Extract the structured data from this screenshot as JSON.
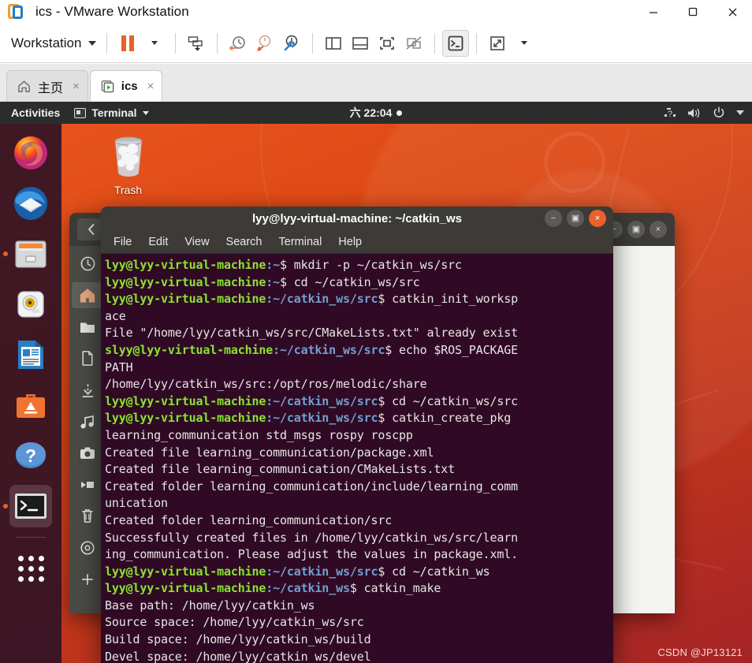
{
  "vmware": {
    "window_title": "ics - VMware Workstation",
    "logo_icon": "vmware-logo-icon",
    "window_buttons": [
      {
        "name": "minimize-button",
        "glyph": "minimize-icon"
      },
      {
        "name": "restore-button",
        "glyph": "restore-icon"
      },
      {
        "name": "close-button",
        "glyph": "close-icon"
      }
    ],
    "toolbar": {
      "menu_label": "Workstation",
      "menu_caret": "chevron-down-icon",
      "buttons": [
        {
          "name": "pause-vm-button",
          "icon": "pause-icon",
          "label": "Pause"
        },
        {
          "name": "pause-dropdown-button",
          "icon": "chevron-down-icon",
          "label": ""
        },
        {
          "name": "manage-snapshot-button",
          "icon": "snapshot-save-icon",
          "label": "Take snapshot"
        },
        {
          "name": "revert-snapshot-button",
          "icon": "snapshot-revert-icon",
          "label": "Revert to snapshot"
        },
        {
          "name": "snapshot-back-button",
          "icon": "snapshot-back-icon",
          "label": "Go back to snapshot"
        },
        {
          "name": "snapshot-manager-button",
          "icon": "snapshot-manager-icon",
          "label": "Manage snapshots"
        },
        {
          "name": "show-library-button",
          "icon": "sidebar-panel-icon",
          "label": "Show or hide library"
        },
        {
          "name": "show-thumbnails-button",
          "icon": "bottom-panel-icon",
          "label": "Show or hide thumbnail bar"
        },
        {
          "name": "fullscreen-button",
          "icon": "fullscreen-icon",
          "label": "Enter full screen"
        },
        {
          "name": "unity-mode-button",
          "icon": "unity-mode-icon",
          "label": "Unity mode"
        },
        {
          "name": "console-view-button",
          "icon": "terminal-console-icon",
          "label": "Console view"
        },
        {
          "name": "stretch-guest-button",
          "icon": "stretch-arrows-icon",
          "label": "Stretch guest"
        },
        {
          "name": "stretch-dropdown-button",
          "icon": "chevron-down-icon",
          "label": ""
        }
      ]
    },
    "tabs": [
      {
        "name": "tab-home",
        "label": "主页",
        "icon": "home-icon",
        "selected": false,
        "close": "×"
      },
      {
        "name": "tab-ics",
        "label": "ics",
        "icon": "vm-running-icon",
        "selected": true,
        "close": "×"
      }
    ]
  },
  "ubuntu": {
    "panel": {
      "activities": "Activities",
      "app_name": "Terminal",
      "app_icon": "terminal-icon",
      "app_caret": "chevron-down-icon",
      "clock": "六 22:04",
      "clock_badge": "notification-dot-icon",
      "right_icons": [
        {
          "name": "keyboard-layout-icon",
          "glyph": "?"
        },
        {
          "name": "volume-icon",
          "glyph": "volume"
        },
        {
          "name": "power-icon",
          "glyph": "power"
        },
        {
          "name": "system-menu-caret-icon",
          "glyph": "caret"
        }
      ]
    },
    "dock": [
      {
        "name": "dock-item-firefox",
        "label": "Firefox",
        "icon": "firefox-icon",
        "running": false
      },
      {
        "name": "dock-item-thunderbird",
        "label": "Thunderbird Mail",
        "icon": "thunderbird-icon",
        "running": false
      },
      {
        "name": "dock-item-files",
        "label": "Files",
        "icon": "files-nautilus-icon",
        "running": true
      },
      {
        "name": "dock-item-rhythmbox",
        "label": "Rhythmbox",
        "icon": "rhythmbox-icon",
        "running": false
      },
      {
        "name": "dock-item-libreoffice-writer",
        "label": "LibreOffice Writer",
        "icon": "libreoffice-writer-icon",
        "running": false
      },
      {
        "name": "dock-item-ubuntu-software",
        "label": "Ubuntu Software",
        "icon": "ubuntu-software-icon",
        "running": false
      },
      {
        "name": "dock-item-help",
        "label": "Help",
        "icon": "help-icon",
        "running": false
      },
      {
        "name": "dock-item-terminal",
        "label": "Terminal",
        "icon": "terminal-icon",
        "running": true
      },
      {
        "name": "dock-item-show-applications",
        "label": "Show Applications",
        "icon": "app-grid-icon",
        "running": false
      }
    ],
    "desktop_icons": [
      {
        "name": "desktop-icon-trash",
        "label": "Trash",
        "icon": "trash-icon"
      }
    ],
    "wallpaper_colors": {
      "top": "#e8561f",
      "mid": "#dd4814",
      "bottom": "#a52426"
    }
  },
  "nautilus": {
    "back_icon": "chevron-left-icon",
    "window_buttons": [
      {
        "name": "nautilus-minimize-button",
        "glyph": "−"
      },
      {
        "name": "nautilus-maximize-button",
        "glyph": "▣"
      },
      {
        "name": "nautilus-close-button",
        "glyph": "×"
      }
    ],
    "sidebar_items": [
      {
        "name": "sidebar-item-recent",
        "icon": "clock-icon",
        "label": "Recent",
        "selected": false
      },
      {
        "name": "sidebar-item-home",
        "icon": "home-icon",
        "label": "Home",
        "selected": true
      },
      {
        "name": "sidebar-item-documents",
        "icon": "folder-icon",
        "label": "Documents",
        "selected": false
      },
      {
        "name": "sidebar-item-desktop",
        "icon": "file-icon",
        "label": "Desktop",
        "selected": false
      },
      {
        "name": "sidebar-item-downloads",
        "icon": "download-icon",
        "label": "Downloads",
        "selected": false
      },
      {
        "name": "sidebar-item-music",
        "icon": "music-note-icon",
        "label": "Music",
        "selected": false
      },
      {
        "name": "sidebar-item-pictures",
        "icon": "camera-icon",
        "label": "Pictures",
        "selected": false
      },
      {
        "name": "sidebar-item-videos",
        "icon": "video-camera-icon",
        "label": "Videos",
        "selected": false
      },
      {
        "name": "sidebar-item-trash",
        "icon": "trash-icon",
        "label": "Trash",
        "selected": false
      },
      {
        "name": "sidebar-item-disc",
        "icon": "disc-icon",
        "label": "Disc",
        "selected": false
      },
      {
        "name": "sidebar-item-other-locations",
        "icon": "plus-icon",
        "label": "Other Locations",
        "selected": false
      }
    ]
  },
  "terminal": {
    "title": "lyy@lyy-virtual-machine: ~/catkin_ws",
    "window_buttons": [
      {
        "name": "terminal-minimize-button",
        "glyph": "−"
      },
      {
        "name": "terminal-maximize-button",
        "glyph": "▣"
      },
      {
        "name": "terminal-close-button",
        "glyph": "×"
      }
    ],
    "menu": [
      "File",
      "Edit",
      "View",
      "Search",
      "Terminal",
      "Help"
    ],
    "colors": {
      "background": "#300a24",
      "user_host": "#8ae234",
      "path": "#729fcf",
      "text": "#e6e6e6"
    },
    "lines": [
      {
        "user": "lyy@lyy-virtual-machine",
        "path": ":~",
        "text": "$ mkdir -p ~/catkin_ws/src"
      },
      {
        "user": "lyy@lyy-virtual-machine",
        "path": ":~",
        "text": "$ cd ~/catkin_ws/src"
      },
      {
        "user": "lyy@lyy-virtual-machine",
        "path": ":~/catkin_ws/src",
        "text": "$ catkin_init_worksp"
      },
      {
        "user": "",
        "path": "",
        "text": "ace"
      },
      {
        "user": "",
        "path": "",
        "text": "File \"/home/lyy/catkin_ws/src/CMakeLists.txt\" already exist"
      },
      {
        "user": "slyy@lyy-virtual-machine",
        "path": ":~/catkin_ws/src",
        "text": "$ echo $ROS_PACKAGE"
      },
      {
        "user": "",
        "path": "",
        "text": "PATH"
      },
      {
        "user": "",
        "path": "",
        "text": "/home/lyy/catkin_ws/src:/opt/ros/melodic/share"
      },
      {
        "user": "lyy@lyy-virtual-machine",
        "path": ":~/catkin_ws/src",
        "text": "$ cd ~/catkin_ws/src"
      },
      {
        "user": "lyy@lyy-virtual-machine",
        "path": ":~/catkin_ws/src",
        "text": "$ catkin_create_pkg"
      },
      {
        "user": "",
        "path": "",
        "text": "learning_communication std_msgs rospy roscpp"
      },
      {
        "user": "",
        "path": "",
        "text": "Created file learning_communication/package.xml"
      },
      {
        "user": "",
        "path": "",
        "text": "Created file learning_communication/CMakeLists.txt"
      },
      {
        "user": "",
        "path": "",
        "text": "Created folder learning_communication/include/learning_comm"
      },
      {
        "user": "",
        "path": "",
        "text": "unication"
      },
      {
        "user": "",
        "path": "",
        "text": "Created folder learning_communication/src"
      },
      {
        "user": "",
        "path": "",
        "text": "Successfully created files in /home/lyy/catkin_ws/src/learn"
      },
      {
        "user": "",
        "path": "",
        "text": "ing_communication. Please adjust the values in package.xml."
      },
      {
        "user": "lyy@lyy-virtual-machine",
        "path": ":~/catkin_ws/src",
        "text": "$ cd ~/catkin_ws"
      },
      {
        "user": "lyy@lyy-virtual-machine",
        "path": ":~/catkin_ws",
        "text": "$ catkin_make"
      },
      {
        "user": "",
        "path": "",
        "text": "Base path: /home/lyy/catkin_ws"
      },
      {
        "user": "",
        "path": "",
        "text": "Source space: /home/lyy/catkin_ws/src"
      },
      {
        "user": "",
        "path": "",
        "text": "Build space: /home/lyy/catkin_ws/build"
      },
      {
        "user": "",
        "path": "",
        "text": "Devel space: /home/lyy/catkin_ws/devel"
      }
    ]
  },
  "watermark": "CSDN @JP13121"
}
